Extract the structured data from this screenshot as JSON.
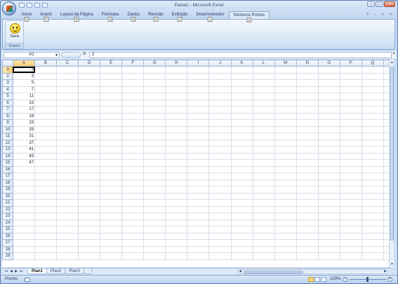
{
  "window": {
    "title": "Pasta1 - Microsoft Excel"
  },
  "title_controls": [
    "−",
    "□",
    "×"
  ],
  "tabs": [
    {
      "label": "Início",
      "key": "C"
    },
    {
      "label": "Inserir",
      "key": "T"
    },
    {
      "label": "Layout da Página",
      "key": "P"
    },
    {
      "label": "Fórmulas",
      "key": "U"
    },
    {
      "label": "Dados",
      "key": "S"
    },
    {
      "label": "Revisão",
      "key": "V"
    },
    {
      "label": "Exibição",
      "key": "J"
    },
    {
      "label": "Desenvolvedor",
      "key": "L"
    },
    {
      "label": "Números Primos",
      "key": "X"
    }
  ],
  "ribbon": {
    "group_caption": "Primos",
    "gera_label": "Gera"
  },
  "formula_bar": {
    "name_box": "A1",
    "fx": "fx",
    "value": "2"
  },
  "columns": [
    "A",
    "B",
    "C",
    "D",
    "E",
    "F",
    "G",
    "H",
    "I",
    "J",
    "K",
    "L",
    "M",
    "N",
    "O",
    "P",
    "Q"
  ],
  "rows": [
    "1",
    "2",
    "3",
    "4",
    "5",
    "6",
    "7",
    "8",
    "9",
    "10",
    "11",
    "12",
    "13",
    "14",
    "15",
    "16",
    "17",
    "18",
    "19",
    "20",
    "21",
    "22",
    "23",
    "24",
    "25",
    "26",
    "27",
    "28",
    "29"
  ],
  "column_a_values": [
    "2",
    "3",
    "5",
    "7",
    "11",
    "13",
    "17",
    "19",
    "23",
    "29",
    "31",
    "37",
    "41",
    "43",
    "47"
  ],
  "sheets": [
    {
      "label": "Plan1",
      "active": true
    },
    {
      "label": "Plan2",
      "active": false
    },
    {
      "label": "Plan3",
      "active": false
    }
  ],
  "status": {
    "text": "Pronto",
    "zoom": "100%"
  }
}
